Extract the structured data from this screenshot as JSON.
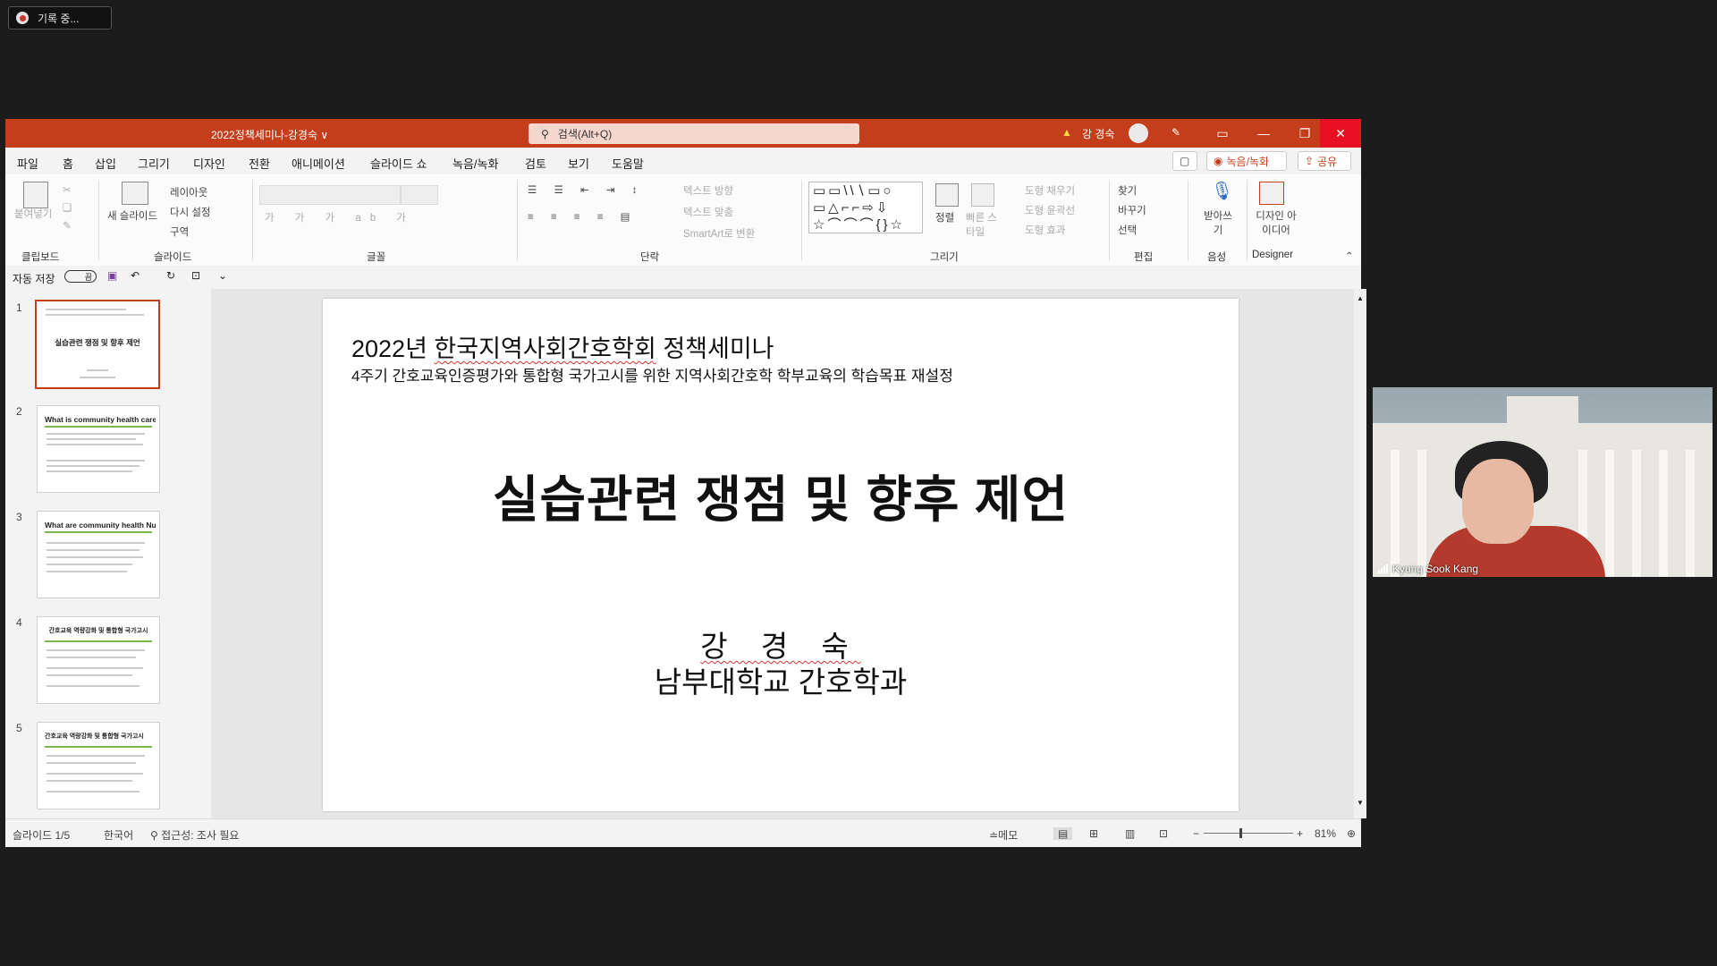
{
  "recording": {
    "label": "기록 중..."
  },
  "titlebar": {
    "doc_title": "2022정책세미나-강경숙 ∨",
    "search_placeholder": "검색(Alt+Q)",
    "user_name": "강 경숙"
  },
  "menu": {
    "items": [
      "파일",
      "홈",
      "삽입",
      "그리기",
      "디자인",
      "전환",
      "애니메이션",
      "슬라이드 쇼",
      "녹음/녹화",
      "검토",
      "보기",
      "도움말"
    ],
    "record_button": "녹음/녹화",
    "share_button": "공유"
  },
  "ribbon": {
    "clipboard": {
      "paste": "붙여넣기",
      "label": "클립보드"
    },
    "slides": {
      "new_slide": "새 슬라이드",
      "layout": "레이아웃",
      "reset": "다시 설정",
      "section": "구역",
      "label": "슬라이드"
    },
    "font": {
      "label": "글꼴"
    },
    "paragraph": {
      "text_direction": "텍스트 방향",
      "align_text": "텍스트 맞춤",
      "smartart": "SmartArt로 변환",
      "label": "단락"
    },
    "drawing": {
      "arrange": "정렬",
      "quick_styles": "빠른 스타일",
      "shape_fill": "도형 채우기",
      "shape_outline": "도형 윤곽선",
      "shape_effects": "도형 효과",
      "label": "그리기"
    },
    "editing": {
      "find": "찾기",
      "replace": "바꾸기",
      "select": "선택",
      "label": "편집"
    },
    "voice": {
      "dictate": "받아쓰기",
      "label": "음성"
    },
    "designer": {
      "ideas": "디자인 아이디어",
      "label": "Designer"
    }
  },
  "qat": {
    "autosave": "자동 저장",
    "toggle": "끔"
  },
  "thumbnails": [
    {
      "num": "1",
      "title": "실습관련 쟁점 및 향후 제언",
      "selected": true
    },
    {
      "num": "2",
      "title": "What is community health care nursing?"
    },
    {
      "num": "3",
      "title": "What are community health Nursing practices?"
    },
    {
      "num": "4",
      "title": "간호교육 역량강화 및 통합형 국가고시"
    },
    {
      "num": "5",
      "title": "간호교육 역량강화 및 통합형 국가고시"
    }
  ],
  "slide": {
    "heading_prefix": "2022년 ",
    "heading_society": "한국지역사회간호학회",
    "heading_suffix": " 정책세미나",
    "subtitle": "4주기 간호교육인증평가와 통합형 국가고시를 위한 지역사회간호학 학부교육의 학습목표 재설정",
    "title": "실습관련 쟁점 및 향후 제언",
    "presenter": "강 경 숙",
    "affiliation": "남부대학교 간호학과"
  },
  "status": {
    "slide_count": "슬라이드 1/5",
    "language": "한국어",
    "accessibility": "접근성: 조사 필요",
    "notes": "메모",
    "zoom": "81%"
  },
  "video": {
    "participant": "Kyung Sook Kang"
  }
}
